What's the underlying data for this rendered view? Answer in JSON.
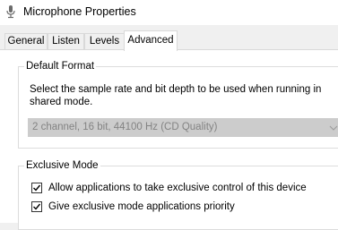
{
  "window": {
    "title": "Microphone Properties",
    "icon": "microphone-icon"
  },
  "tabs": [
    {
      "label": "General",
      "active": false
    },
    {
      "label": "Listen",
      "active": false
    },
    {
      "label": "Levels",
      "active": false
    },
    {
      "label": "Advanced",
      "active": true
    }
  ],
  "default_format": {
    "group_title": "Default Format",
    "description": "Select the sample rate and bit depth to be used when running in shared mode.",
    "selected_value": "2 channel, 16 bit, 44100 Hz (CD Quality)",
    "disabled": true
  },
  "exclusive_mode": {
    "group_title": "Exclusive Mode",
    "options": [
      {
        "label": "Allow applications to take exclusive control of this device",
        "checked": true
      },
      {
        "label": "Give exclusive mode applications priority",
        "checked": true
      }
    ]
  },
  "colors": {
    "window_bg": "#ffffff",
    "tab_bg": "#f0f0f0",
    "disabled_select_bg": "#cccccc",
    "disabled_text": "#838383"
  }
}
